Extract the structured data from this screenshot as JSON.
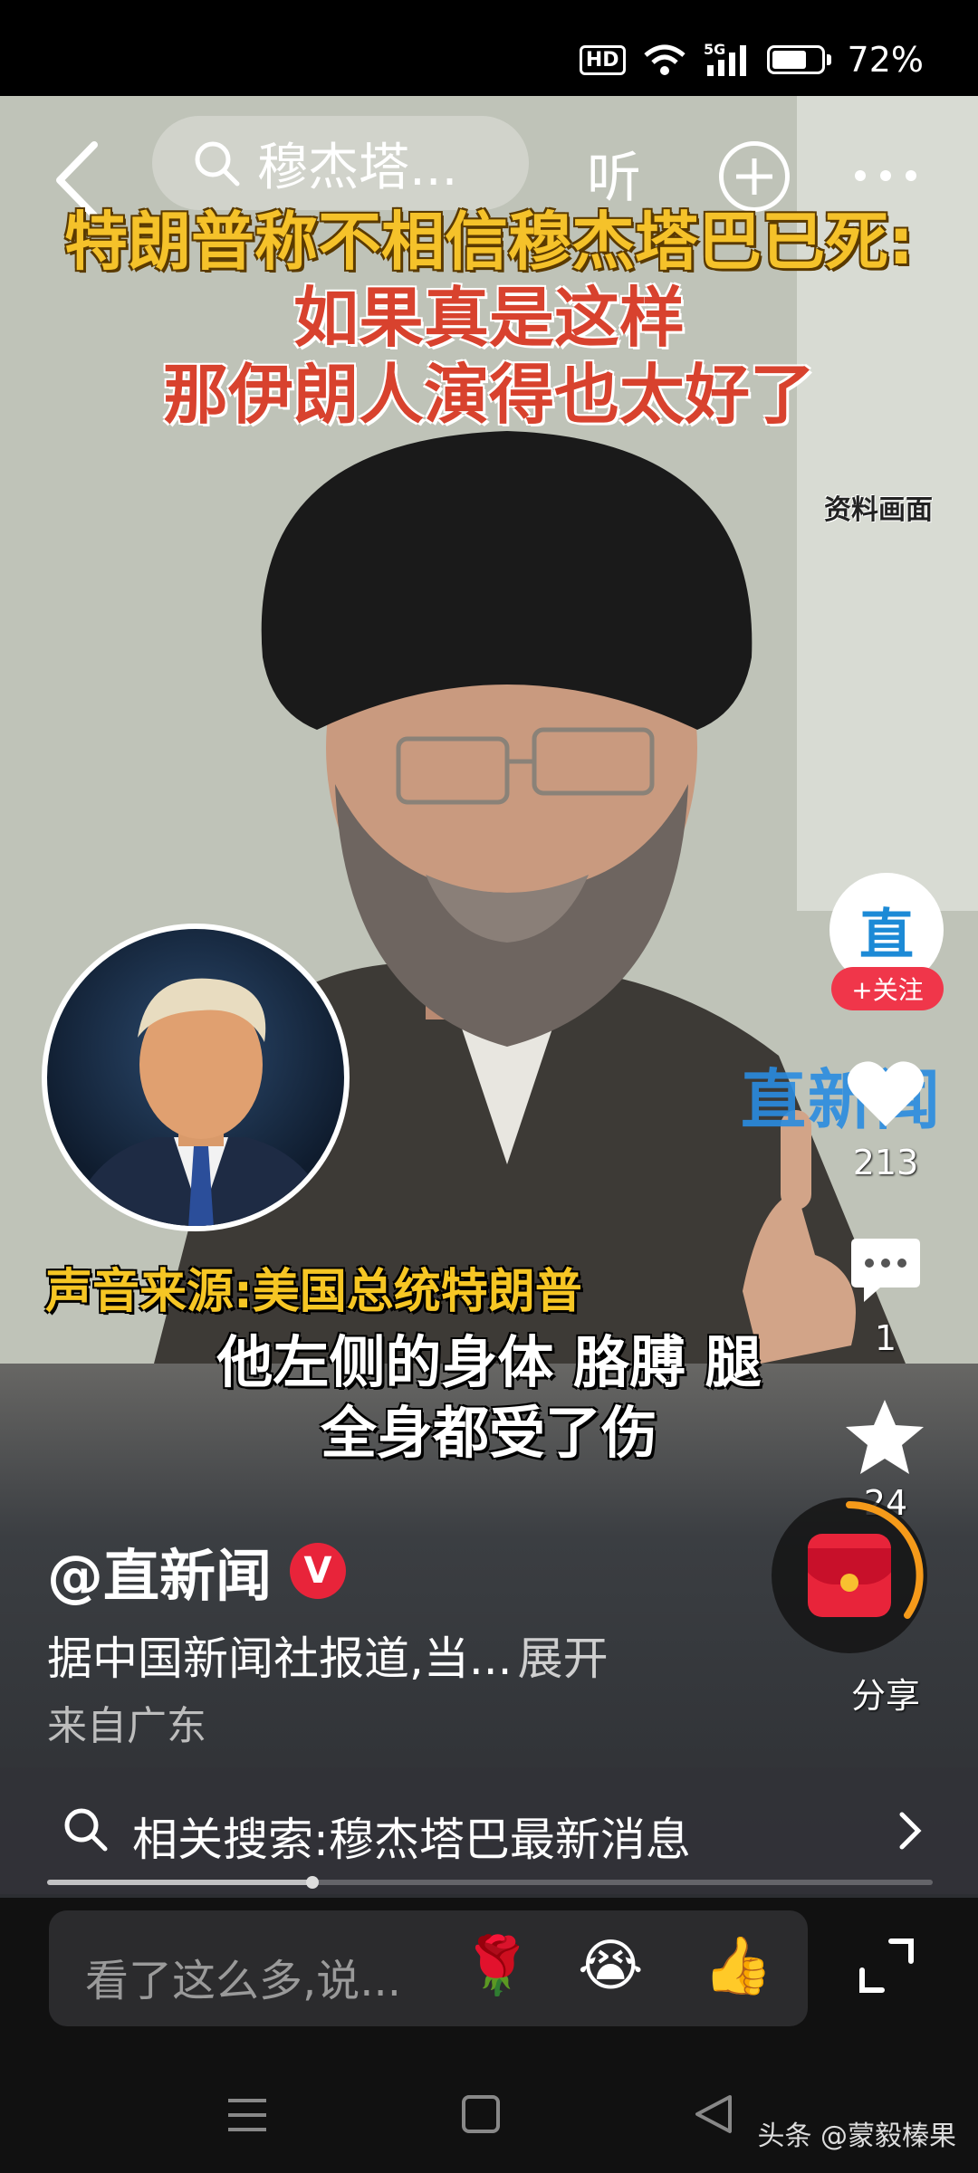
{
  "status_bar": {
    "hd": "HD",
    "network": "5G",
    "battery": "72%",
    "battery_level": 0.72
  },
  "top_bar": {
    "search_text": "穆杰塔...",
    "listen_label": "听"
  },
  "video": {
    "headline_line1": "特朗普称不相信穆杰塔巴已死:",
    "headline_line2": "如果真是这样",
    "headline_line3": "那伊朗人演得也太好了",
    "source_tag": "资料画面",
    "watermark": "直新闻",
    "voice_caption": "声音来源:美国总统特朗普",
    "subtitle_line1": "他左侧的身体 胳膊 腿",
    "subtitle_line2": "全身都受了伤"
  },
  "actions": {
    "avatar_text": "直",
    "follow_label": "+关注",
    "like_count": "213",
    "comment_count": "1",
    "star_count": "24",
    "share_label": "分享"
  },
  "info": {
    "author": "@直新闻",
    "verified": "V",
    "description": "据中国新闻社报道,当...",
    "expand_label": "展开",
    "location": "来自广东"
  },
  "related_search": {
    "text": "相关搜索:穆杰塔巴最新消息"
  },
  "progress": {
    "fraction": 0.3
  },
  "comment_bar": {
    "placeholder": "看了这么多,说...",
    "emojis": [
      "🌹",
      "😭",
      "👍"
    ]
  },
  "credit": "头条 @蒙毅榛果",
  "colors": {
    "accent_red": "#f0364a",
    "headline_gold": "#f5c22a",
    "headline_red": "#d8422e",
    "brand_blue": "#1c8ad6"
  }
}
